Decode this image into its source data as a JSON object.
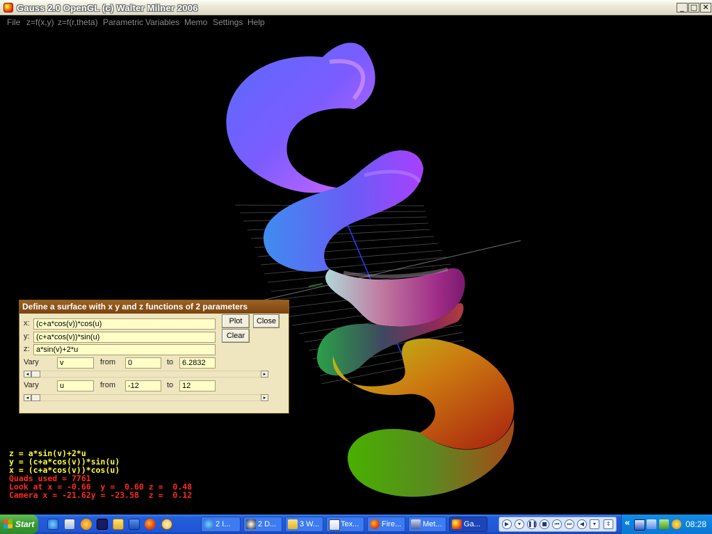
{
  "window": {
    "title": "Gauss 2.0 OpenGL (c) Walter Milner 2006",
    "minimize": "_",
    "maximize": "□",
    "close": "✕"
  },
  "menu": [
    "File",
    "z=f(x,y)",
    "z=f(r,theta)",
    "Parametric",
    "Variables",
    "Memo",
    "Settings",
    "Help"
  ],
  "dialog": {
    "title": "Define a surface with x y and z functions of 2 parameters",
    "x_label": "x:",
    "y_label": "y:",
    "z_label": "z:",
    "x_expr": "(c+a*cos(v))*cos(u)",
    "y_expr": "(c+a*cos(v))*sin(u)",
    "z_expr": "a*sin(v)+2*u",
    "plot_button": "Plot",
    "close_button": "Close",
    "clear_button": "Clear",
    "vary1": {
      "label": "Vary",
      "var": "v",
      "from_label": "from",
      "from": "0",
      "to_label": "to",
      "to": "6.2832"
    },
    "vary2": {
      "label": "Vary",
      "var": "u",
      "from_label": "from",
      "from": "-12",
      "to_label": "to",
      "to": "12"
    }
  },
  "info": {
    "line1": "z = a*sin(v)+2*u",
    "line2": "y = (c+a*cos(v))*sin(u)",
    "line3": "x = (c+a*cos(v))*cos(u)",
    "line4": "Quads used = 7761",
    "line5": "Look at x = -0.66  y =  0.60 z =  0.48",
    "line6": "Camera x = -21.62y = -23.58  z =  0.12"
  },
  "taskbar": {
    "start": "Start",
    "tasks": [
      {
        "label": "2 I...",
        "active": false
      },
      {
        "label": "2 D...",
        "active": false
      },
      {
        "label": "3 W...",
        "active": false
      },
      {
        "label": "Tex...",
        "active": false
      },
      {
        "label": "Fire...",
        "active": false
      },
      {
        "label": "Met...",
        "active": false
      },
      {
        "label": "Ga...",
        "active": true
      }
    ],
    "tray_chevron": "«",
    "clock": "08:28"
  },
  "colors": {
    "info_yellow": "#ffff3a",
    "info_red": "#ff2a1a",
    "dialog_title": "#8b5319",
    "dialog_bg": "#efe6c0"
  }
}
